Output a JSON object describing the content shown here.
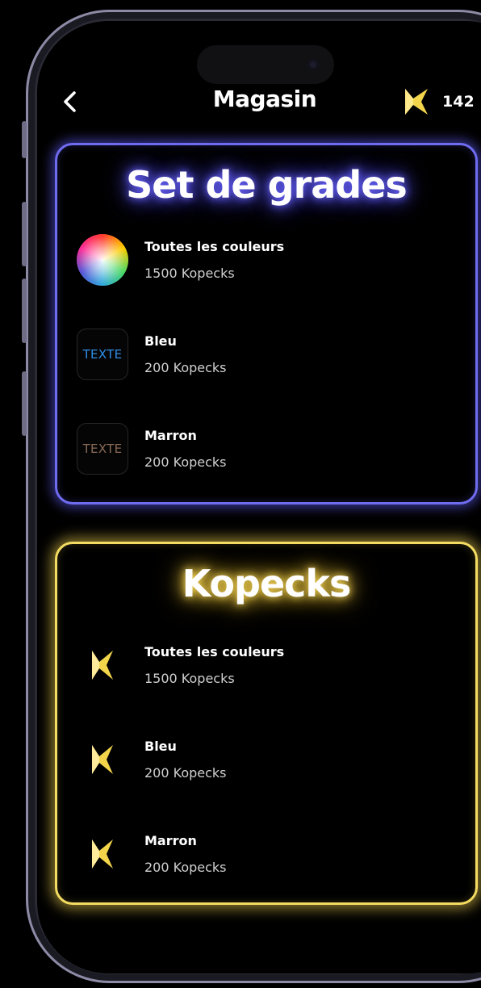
{
  "header": {
    "title": "Magasin",
    "balance": "142"
  },
  "colors": {
    "grades_accent": "#6f6cf0",
    "kopecks_accent": "#f4dc62",
    "blue_text": "#2e8ee8",
    "brown_text": "#8a6a55",
    "kopeck_icon": "#f2d54a"
  },
  "icons": {
    "back": "chevron-left-icon",
    "currency": "kopeck-k-icon",
    "color_wheel": "color-wheel-icon"
  },
  "grades": {
    "title": "Set de grades",
    "items": [
      {
        "name": "Toutes les couleurs",
        "price": "1500 Kopecks",
        "icon": "color-wheel"
      },
      {
        "name": "Bleu",
        "price": "200 Kopecks",
        "icon": "text-swatch",
        "swatch_text": "TEXTE"
      },
      {
        "name": "Marron",
        "price": "200 Kopecks",
        "icon": "text-swatch",
        "swatch_text": "TEXTE"
      }
    ]
  },
  "kopecks": {
    "title": "Kopecks",
    "items": [
      {
        "name": "Toutes les couleurs",
        "price": "1500 Kopecks",
        "icon": "kopeck"
      },
      {
        "name": "Bleu",
        "price": "200 Kopecks",
        "icon": "kopeck"
      },
      {
        "name": "Marron",
        "price": "200 Kopecks",
        "icon": "kopeck"
      }
    ]
  }
}
